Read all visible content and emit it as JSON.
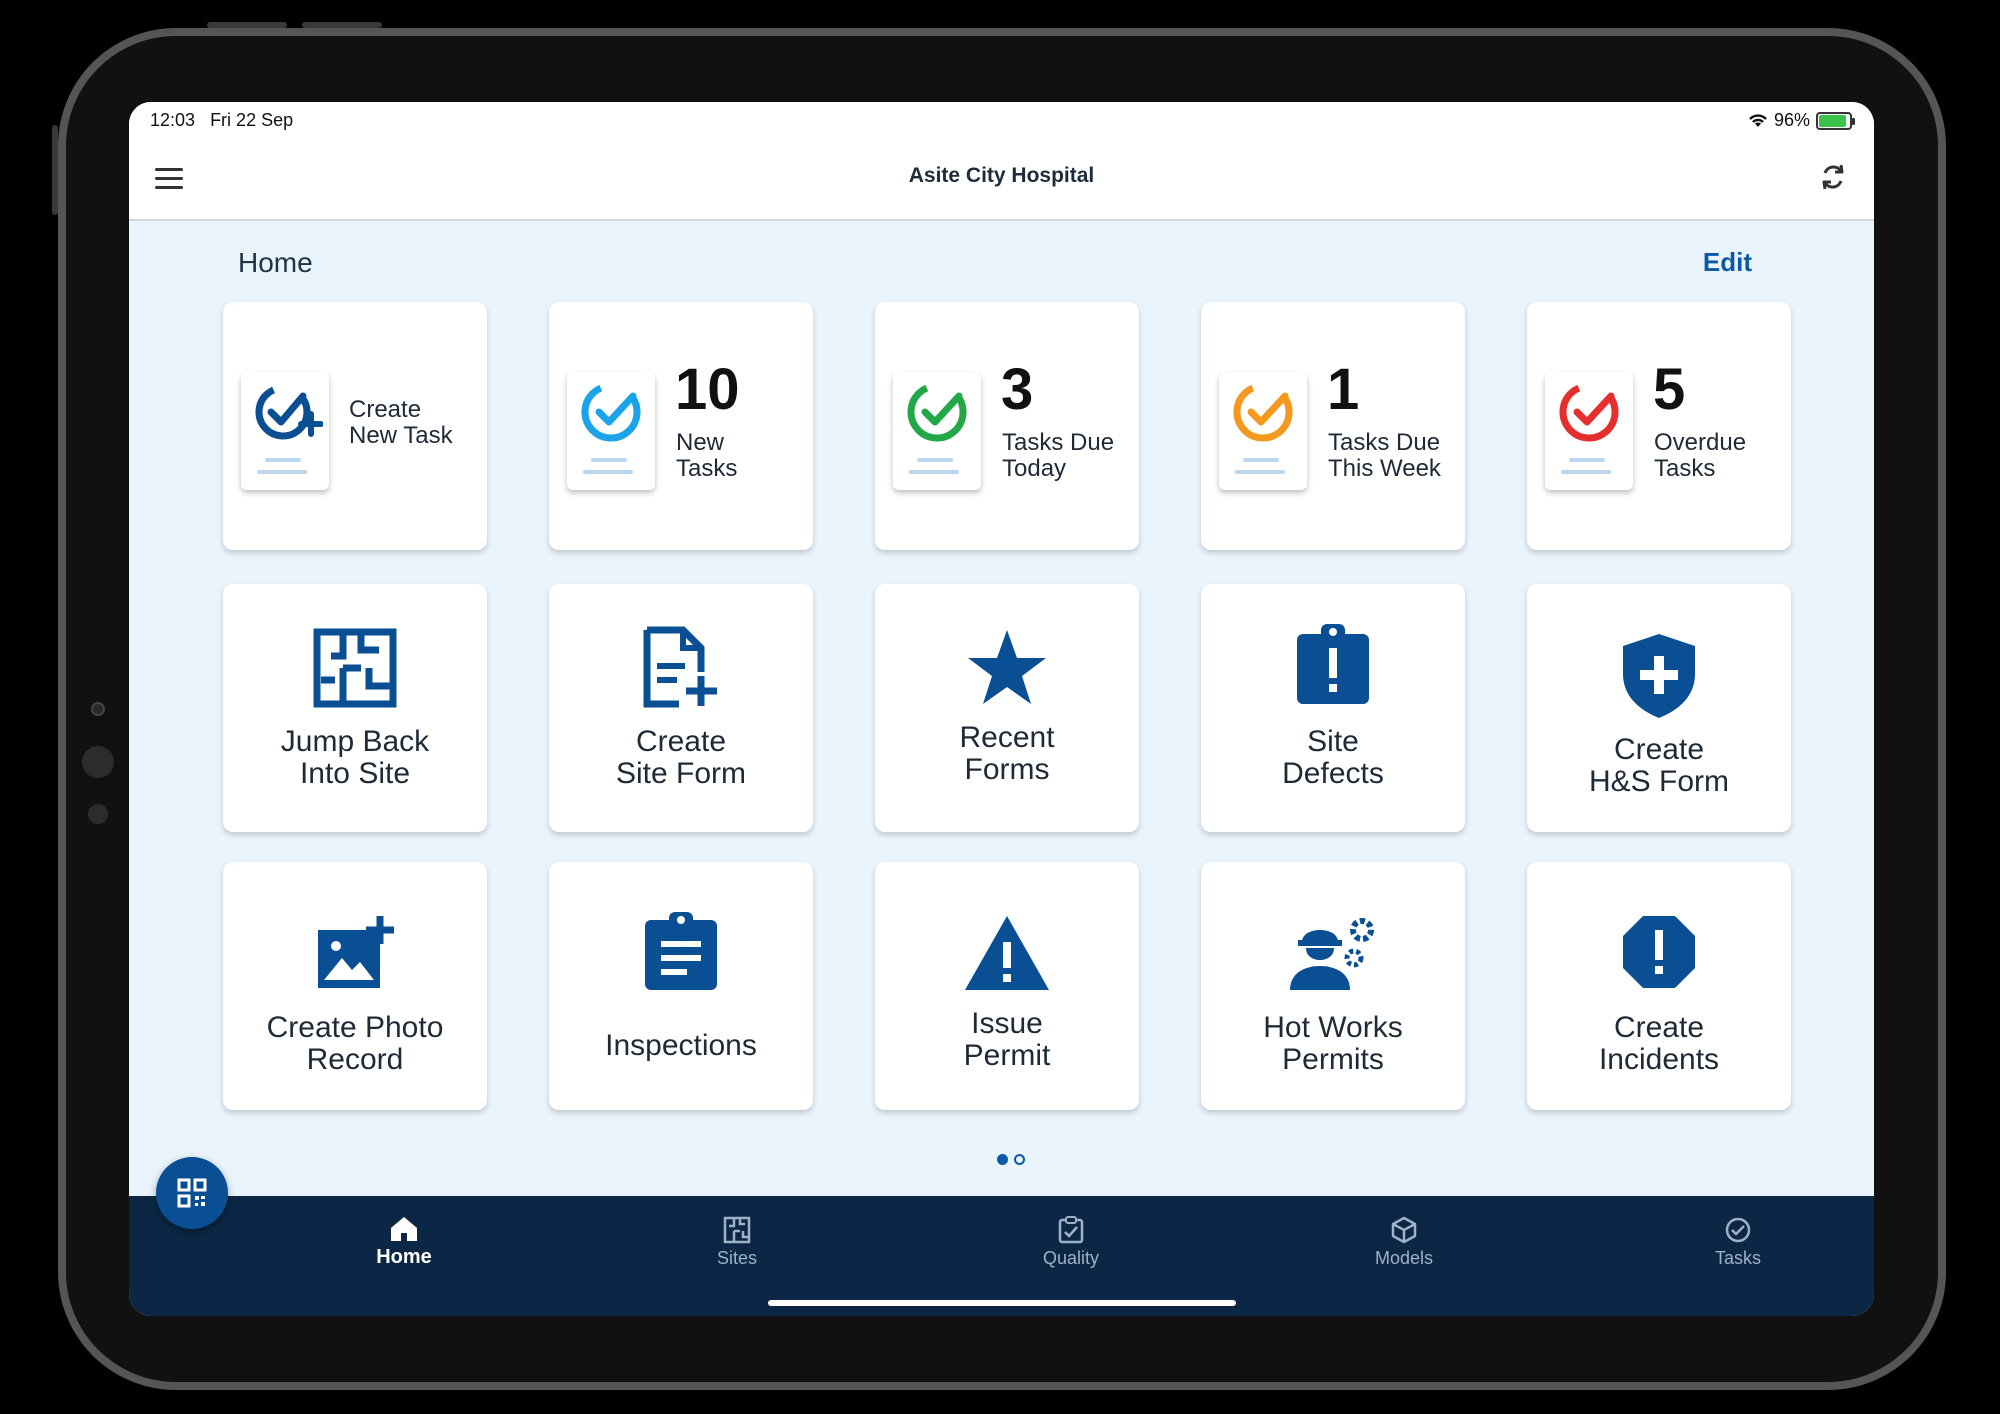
{
  "status": {
    "time": "12:03",
    "date": "Fri 22 Sep",
    "battery": "96%"
  },
  "app": {
    "title": "Asite City Hospital"
  },
  "home": {
    "title": "Home",
    "edit_label": "Edit"
  },
  "task_tiles": [
    {
      "number": "",
      "label": "Create\nNew Task",
      "color": "#0a4f93"
    },
    {
      "number": "10",
      "label": "New\nTasks",
      "color": "#1aa3e8"
    },
    {
      "number": "3",
      "label": "Tasks Due\nToday",
      "color": "#22a846"
    },
    {
      "number": "1",
      "label": "Tasks Due\nThis Week",
      "color": "#f39a1e"
    },
    {
      "number": "5",
      "label": "Overdue\nTasks",
      "color": "#e52f2f"
    }
  ],
  "action_tiles": [
    {
      "label": "Jump Back\nInto Site",
      "icon": "floorplan-icon"
    },
    {
      "label": "Create\nSite Form",
      "icon": "form-add-icon"
    },
    {
      "label": "Recent\nForms",
      "icon": "star-icon"
    },
    {
      "label": "Site\nDefects",
      "icon": "clipboard-alert-icon"
    },
    {
      "label": "Create\nH&S Form",
      "icon": "shield-plus-icon"
    },
    {
      "label": "Create Photo\nRecord",
      "icon": "photo-add-icon"
    },
    {
      "label": "Inspections",
      "icon": "clipboard-list-icon"
    },
    {
      "label": "Issue\nPermit",
      "icon": "warning-icon"
    },
    {
      "label": "Hot Works\nPermits",
      "icon": "worker-gears-icon"
    },
    {
      "label": "Create\nIncidents",
      "icon": "octagon-alert-icon"
    }
  ],
  "nav": [
    {
      "label": "Home",
      "active": true
    },
    {
      "label": "Sites",
      "active": false
    },
    {
      "label": "Quality",
      "active": false
    },
    {
      "label": "Models",
      "active": false
    },
    {
      "label": "Tasks",
      "active": false
    }
  ],
  "colors": {
    "primary": "#0a4f93",
    "nav_bg": "#0b2745",
    "screen_bg": "#eaf4fd"
  }
}
